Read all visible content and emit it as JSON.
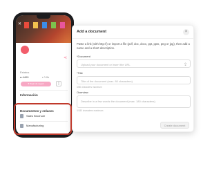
{
  "profile": {
    "share_icon": "share-icon",
    "status_label": "Estatus",
    "status_value": "● 4400",
    "status_meta": "▪ 0.0k",
    "follow_button": "♥ Dejar de seguir",
    "info_title": "Información",
    "docs_title": "Documentos y enlaces",
    "documents": [
      {
        "label": "Sales Brochure"
      },
      {
        "label": "Manufacturing"
      }
    ]
  },
  "dialog": {
    "title": "Add a document",
    "description": "Paste a link (with http://) or import a file (pdf, doc, docx, ppt, pptx, png or jpg), then add a name and a short description.",
    "document_label": "*Document",
    "document_placeholder": "Upload your document or insert the URL",
    "title_label": "*Title",
    "title_placeholder": "Title of the document (max. 80 characters)",
    "title_hint": "0/80 characters maximum",
    "overview_label": "Overview",
    "overview_placeholder": "Describe in a few words the document (max. 180 characters)",
    "overview_hint": "0/180 characters maximum",
    "create_button": "Create document",
    "close_icon": "×",
    "upload_icon": "⇪"
  },
  "colors": {
    "accent": "#f7718f",
    "highlight": "#c0392b"
  }
}
